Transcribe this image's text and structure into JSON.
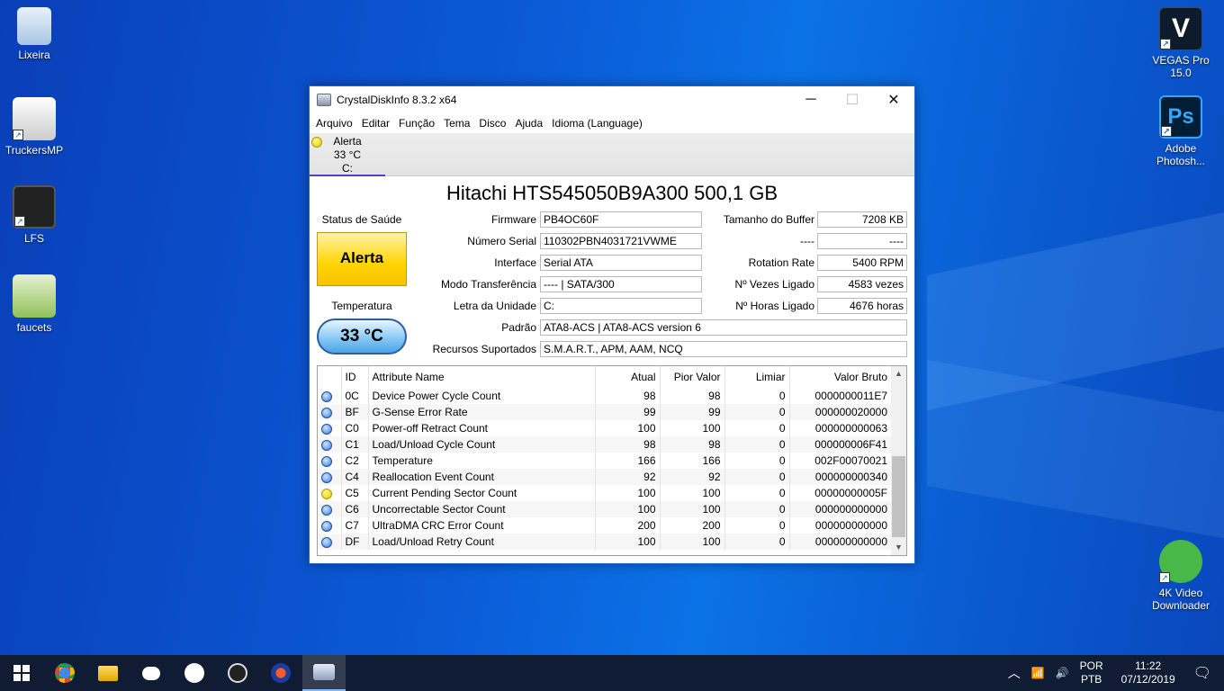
{
  "desktop": {
    "left_icons": [
      {
        "label": "Lixeira"
      },
      {
        "label": "TruckersMP"
      },
      {
        "label": "LFS"
      },
      {
        "label": "faucets"
      }
    ],
    "right_icons": [
      {
        "label": "VEGAS Pro 15.0",
        "glyph": "V"
      },
      {
        "label": "Adobe Photosh...",
        "glyph": "Ps"
      },
      {
        "label": "4K Video Downloader"
      }
    ]
  },
  "window": {
    "title": "CrystalDiskInfo 8.3.2 x64",
    "menu": [
      "Arquivo",
      "Editar",
      "Função",
      "Tema",
      "Disco",
      "Ajuda",
      "Idioma (Language)"
    ],
    "disk_tab": {
      "status": "Alerta",
      "temp": "33 °C",
      "drive": "C:"
    },
    "disk_title": "Hitachi HTS545050B9A300 500,1 GB",
    "health_label": "Status de Saúde",
    "health_value": "Alerta",
    "temp_label": "Temperatura",
    "temp_value": "33 °C",
    "info": {
      "firmware_label": "Firmware",
      "firmware": "PB4OC60F",
      "serial_label": "Número Serial",
      "serial": "110302PBN4031721VWME",
      "interface_label": "Interface",
      "interface": "Serial ATA",
      "transfer_label": "Modo Transferência",
      "transfer": "---- | SATA/300",
      "letter_label": "Letra da Unidade",
      "letter": "C:",
      "standard_label": "Padrão",
      "standard": "ATA8-ACS | ATA8-ACS version 6",
      "features_label": "Recursos Suportados",
      "features": "S.M.A.R.T., APM, AAM, NCQ",
      "buffer_label": "Tamanho do Buffer",
      "buffer": "7208 KB",
      "blank_label": "----",
      "blank": "----",
      "rotation_label": "Rotation Rate",
      "rotation": "5400 RPM",
      "poweron_count_label": "Nº Vezes Ligado",
      "poweron_count": "4583 vezes",
      "poweron_hours_label": "Nº Horas Ligado",
      "poweron_hours": "4676 horas"
    },
    "smart": {
      "headers": [
        "ID",
        "Attribute Name",
        "Atual",
        "Pior Valor",
        "Limiar",
        "Valor Bruto"
      ],
      "rows": [
        {
          "status": "good",
          "id": "0C",
          "name": "Device Power Cycle Count",
          "current": "98",
          "worst": "98",
          "threshold": "0",
          "raw": "0000000011E7"
        },
        {
          "status": "good",
          "id": "BF",
          "name": "G-Sense Error Rate",
          "current": "99",
          "worst": "99",
          "threshold": "0",
          "raw": "000000020000"
        },
        {
          "status": "good",
          "id": "C0",
          "name": "Power-off Retract Count",
          "current": "100",
          "worst": "100",
          "threshold": "0",
          "raw": "000000000063"
        },
        {
          "status": "good",
          "id": "C1",
          "name": "Load/Unload Cycle Count",
          "current": "98",
          "worst": "98",
          "threshold": "0",
          "raw": "000000006F41"
        },
        {
          "status": "good",
          "id": "C2",
          "name": "Temperature",
          "current": "166",
          "worst": "166",
          "threshold": "0",
          "raw": "002F00070021"
        },
        {
          "status": "good",
          "id": "C4",
          "name": "Reallocation Event Count",
          "current": "92",
          "worst": "92",
          "threshold": "0",
          "raw": "000000000340"
        },
        {
          "status": "caution",
          "id": "C5",
          "name": "Current Pending Sector Count",
          "current": "100",
          "worst": "100",
          "threshold": "0",
          "raw": "00000000005F"
        },
        {
          "status": "good",
          "id": "C6",
          "name": "Uncorrectable Sector Count",
          "current": "100",
          "worst": "100",
          "threshold": "0",
          "raw": "000000000000"
        },
        {
          "status": "good",
          "id": "C7",
          "name": "UltraDMA CRC Error Count",
          "current": "200",
          "worst": "200",
          "threshold": "0",
          "raw": "000000000000"
        },
        {
          "status": "good",
          "id": "DF",
          "name": "Load/Unload Retry Count",
          "current": "100",
          "worst": "100",
          "threshold": "0",
          "raw": "000000000000"
        }
      ]
    }
  },
  "taskbar": {
    "apps": [
      "start-icon",
      "chrome-icon",
      "file-explorer-icon",
      "discord-icon",
      "steam-icon",
      "obs-icon",
      "app-icon",
      "crystaldiskinfo-icon"
    ],
    "lang_top": "POR",
    "lang_bottom": "PTB",
    "time": "11:22",
    "date": "07/12/2019"
  }
}
